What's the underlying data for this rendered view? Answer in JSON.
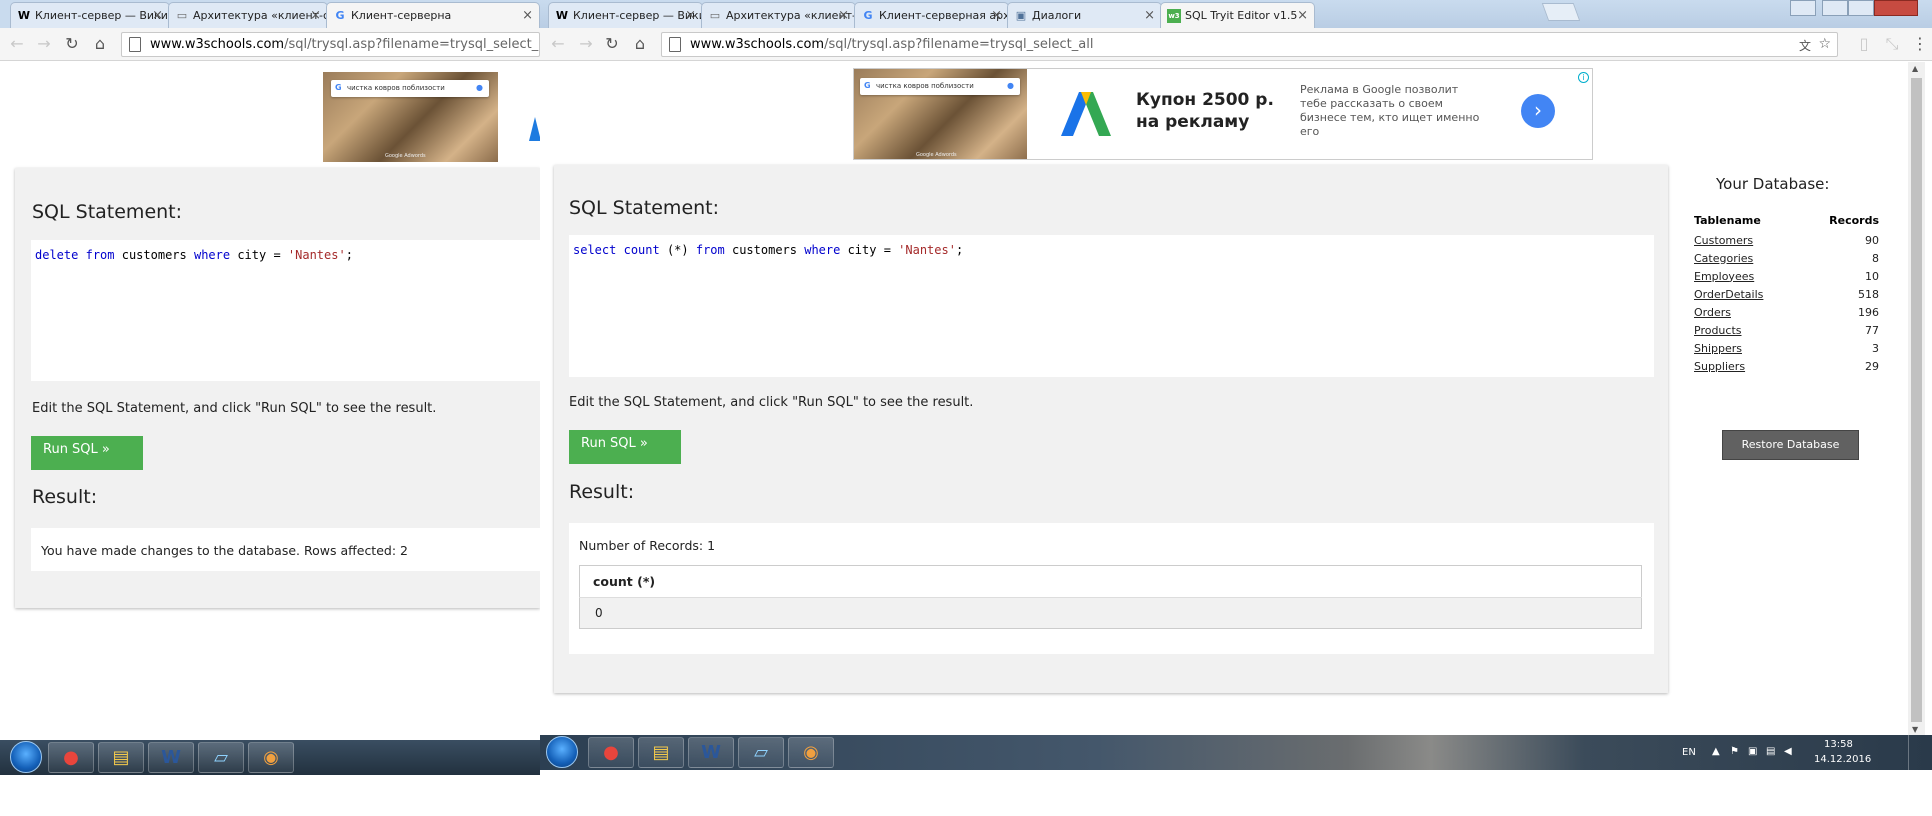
{
  "back_window": {
    "tabs": [
      {
        "label": "Клиент-сервер — Вики",
        "favicon": "W"
      },
      {
        "label": "Архитектура «клиент-се",
        "favicon": "book"
      },
      {
        "label": "Клиент-серверна",
        "favicon": "G"
      }
    ],
    "url_host": "www.w3schools.com",
    "url_path": "/sql/trysql.asp?filename=trysql_select_all",
    "ad_search_text": "чистка ковров поблизости",
    "ad_caption": "Google Adwords",
    "sql_heading": "SQL Statement:",
    "sql_tokens": [
      {
        "t": "delete",
        "c": "kw"
      },
      {
        "t": " ",
        "c": ""
      },
      {
        "t": "from",
        "c": "kw"
      },
      {
        "t": " customers ",
        "c": ""
      },
      {
        "t": "where",
        "c": "kw"
      },
      {
        "t": " city = ",
        "c": ""
      },
      {
        "t": "'Nantes'",
        "c": "str"
      },
      {
        "t": ";",
        "c": ""
      }
    ],
    "instruction": "Edit the SQL Statement, and click \"Run SQL\" to see the result.",
    "run_label": "Run SQL »",
    "result_heading": "Result:",
    "result_message": "You have made changes to the database. Rows affected: 2"
  },
  "front_window": {
    "tabs": [
      {
        "label": "Клиент-сервер — Вики",
        "favicon": "W"
      },
      {
        "label": "Архитектура «клиент-се",
        "favicon": "book"
      },
      {
        "label": "Клиент-серверная архи",
        "favicon": "G"
      },
      {
        "label": "Диалоги",
        "favicon": "vk"
      },
      {
        "label": "SQL Tryit Editor v1.5",
        "favicon": "w3"
      }
    ],
    "url_host": "www.w3schools.com",
    "url_path": "/sql/trysql.asp?filename=trysql_select_all",
    "ad": {
      "search_text": "чистка ковров поблизости",
      "caption": "Google Adwords",
      "headline": "Купон 2500 р. на рекламу",
      "body": "Реклама в Google позволит тебе рассказать о своем бизнесе тем, кто ищет именно его",
      "go": "›",
      "info": "i"
    },
    "sql_heading": "SQL Statement:",
    "sql_tokens": [
      {
        "t": "select",
        "c": "kw"
      },
      {
        "t": " ",
        "c": ""
      },
      {
        "t": "count",
        "c": "kw"
      },
      {
        "t": " (*) ",
        "c": ""
      },
      {
        "t": "from",
        "c": "kw"
      },
      {
        "t": " customers ",
        "c": ""
      },
      {
        "t": "where",
        "c": "kw"
      },
      {
        "t": " city = ",
        "c": ""
      },
      {
        "t": "'Nantes'",
        "c": "str"
      },
      {
        "t": ";",
        "c": ""
      }
    ],
    "instruction": "Edit the SQL Statement, and click \"Run SQL\" to see the result.",
    "run_label": "Run SQL »",
    "result_heading": "Result:",
    "records_label": "Number of Records: 1",
    "result_table": {
      "columns": [
        "count (*)"
      ],
      "rows": [
        [
          "0"
        ]
      ]
    },
    "database": {
      "title": "Your Database:",
      "col_table": "Tablename",
      "col_records": "Records",
      "tables": [
        {
          "name": "Customers",
          "records": "90"
        },
        {
          "name": "Categories",
          "records": "8"
        },
        {
          "name": "Employees",
          "records": "10"
        },
        {
          "name": "OrderDetails",
          "records": "518"
        },
        {
          "name": "Orders",
          "records": "196"
        },
        {
          "name": "Products",
          "records": "77"
        },
        {
          "name": "Shippers",
          "records": "3"
        },
        {
          "name": "Suppliers",
          "records": "29"
        }
      ],
      "restore_label": "Restore Database"
    }
  },
  "taskbar": {
    "apps": [
      "start-orb",
      "chrome-icon",
      "explorer-icon",
      "word-icon",
      "notepad-icon",
      "paint-icon"
    ],
    "language": "EN",
    "time": "13:58",
    "date": "14.12.2016"
  },
  "colors": {
    "green": "#4caf50",
    "keyword": "#0000cd",
    "string": "#a52a2a",
    "restore": "#616161"
  }
}
